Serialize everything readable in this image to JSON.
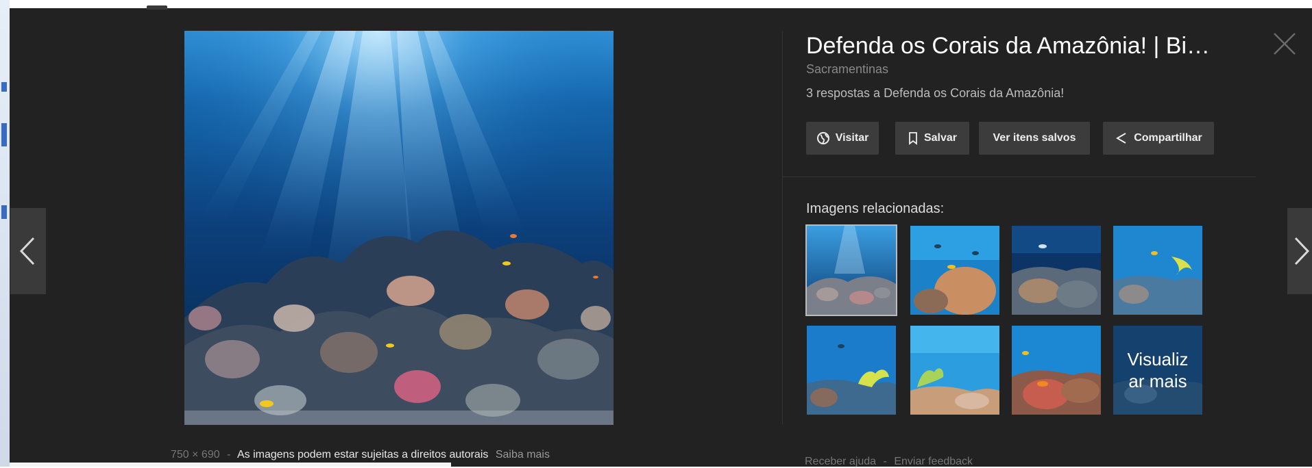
{
  "image": {
    "dimensions": "750 × 690",
    "copyright_notice": "As imagens podem estar sujeitas a direitos autorais",
    "learn_more": "Saiba mais"
  },
  "panel": {
    "title": "Defenda os Corais da Amazônia! | Bi…",
    "source": "Sacramentinas",
    "description": "3 respostas a Defenda os Corais da Amazônia!",
    "buttons": {
      "visit": "Visitar",
      "save": "Salvar",
      "view_saved": "Ver itens salvos",
      "share": "Compartilhar"
    },
    "related_label": "Imagens relacionadas:",
    "view_more": "Visualiz ar mais",
    "view_more_line1": "Visualiz",
    "view_more_line2": "ar mais"
  },
  "footer": {
    "help": "Receber ajuda",
    "feedback": "Enviar feedback"
  },
  "icons": {
    "visit": "globe-icon",
    "save": "bookmark-icon",
    "share": "share-icon",
    "close": "close-icon",
    "prev": "chevron-left-icon",
    "next": "chevron-right-icon"
  },
  "colors": {
    "background": "#222222",
    "button": "#3c3c3c",
    "title": "#ffffff"
  }
}
